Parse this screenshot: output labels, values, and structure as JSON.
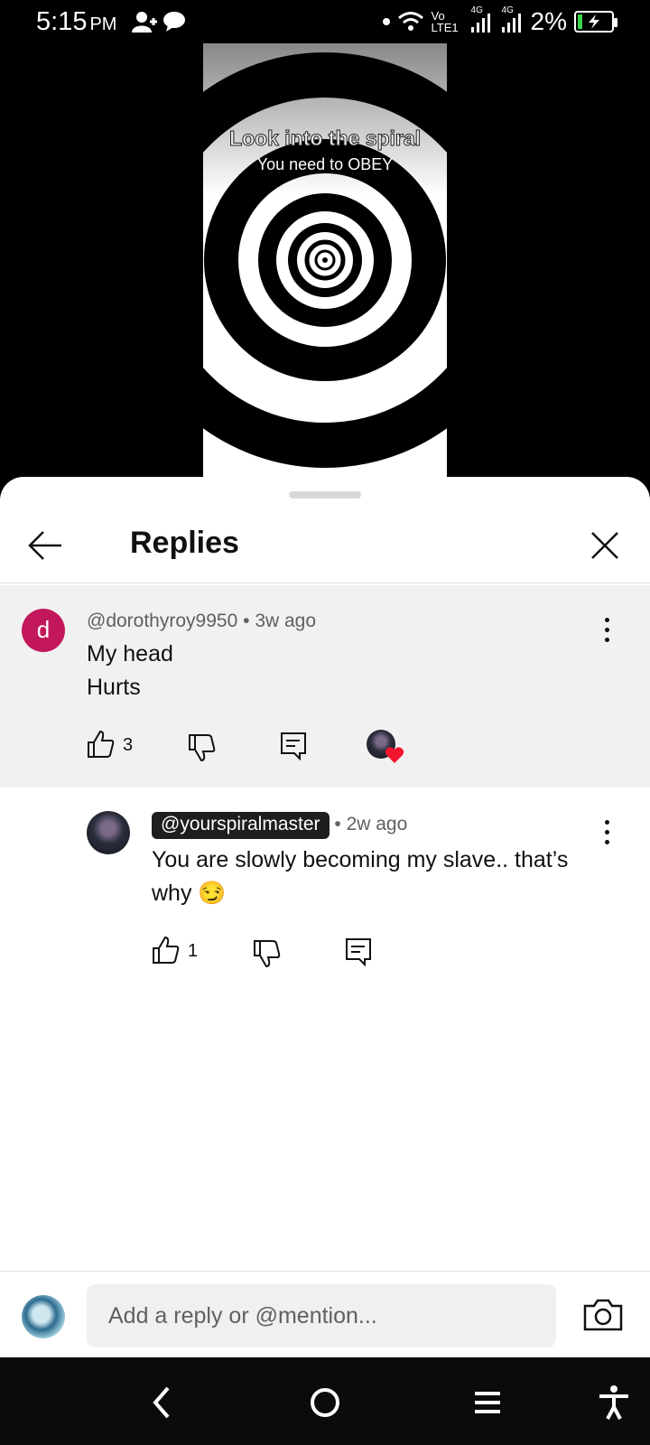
{
  "status_bar": {
    "time": "5:15",
    "ampm": "PM",
    "network_label": "Vo LTE1",
    "network_gen_1": "4G",
    "network_gen_2": "4G",
    "battery": "2%",
    "battery_fill_fraction": 0.02,
    "battery_color": "#3ad54a"
  },
  "video": {
    "caption_line1": "Look into the spiral",
    "caption_line2": "You need to OBEY"
  },
  "sheet": {
    "title": "Replies",
    "back_icon": "arrow-left-icon",
    "close_icon": "close-icon"
  },
  "parent_comment": {
    "avatar_letter": "d",
    "avatar_color": "#c2185b",
    "author": "@dorothyroy9950",
    "separator": "•",
    "time": "3w ago",
    "text_line1": "My head",
    "text_line2": "Hurts",
    "likes": "3",
    "background": "#f1f1f1"
  },
  "reply": {
    "author": "@yourspiralmaster",
    "separator": "•",
    "time": "2w ago",
    "text_line1": "You are slowly becoming my slave.. that’s",
    "text_line2": "why 😏",
    "likes": "1"
  },
  "composer": {
    "placeholder": "Add a reply or @mention...",
    "camera_icon": "camera-icon"
  },
  "nav_bar": {
    "icons": [
      "back-nav-icon",
      "home-nav-icon",
      "menu-nav-icon",
      "accessibility-icon"
    ]
  }
}
